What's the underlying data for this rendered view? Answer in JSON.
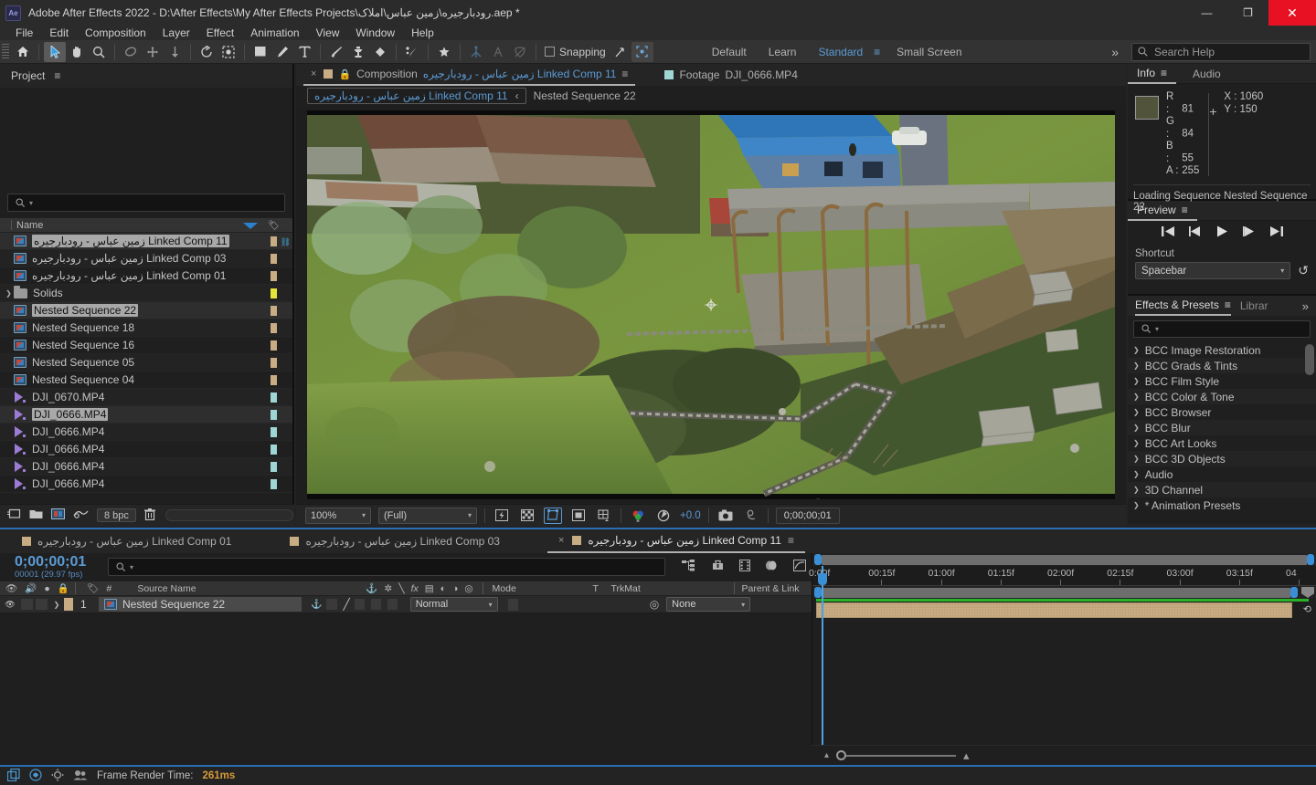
{
  "window": {
    "title": "Adobe After Effects 2022 - D:\\After Effects\\My After Effects Projects\\رودبارجیره\\زمین عباس\\املاک.aep *",
    "logo": "Ae",
    "minimize": "—",
    "maximize": "❐",
    "close": "✕"
  },
  "menu": [
    "File",
    "Edit",
    "Composition",
    "Layer",
    "Effect",
    "Animation",
    "View",
    "Window",
    "Help"
  ],
  "toolbar": {
    "snapping_label": "Snapping",
    "workspaces": [
      "Default",
      "Learn",
      "Standard",
      "Small Screen"
    ],
    "active_workspace": "Standard",
    "overflow": "»",
    "search_placeholder": "Search Help"
  },
  "project": {
    "tab_label": "Project",
    "menu_glyph": "≡",
    "search_placeholder": "",
    "column_name": "Name",
    "bit_depth": "8 bpc",
    "items": [
      {
        "label": "زمین عباس - رودبارجیره Linked Comp 11",
        "type": "comp",
        "swatch": "#c8ad84",
        "selected": true,
        "shared": true,
        "indent": false
      },
      {
        "label": "زمین عباس - رودبارجیره Linked Comp 03",
        "type": "comp",
        "swatch": "#c8ad84",
        "selected": false,
        "shared": false,
        "indent": false
      },
      {
        "label": "زمین عباس - رودبارجیره Linked Comp 01",
        "type": "comp",
        "swatch": "#c8ad84",
        "selected": false,
        "shared": false,
        "indent": false
      },
      {
        "label": "Solids",
        "type": "folder",
        "swatch": "#e4e43a",
        "selected": false,
        "shared": false,
        "indent": true
      },
      {
        "label": "Nested Sequence 22",
        "type": "comp",
        "swatch": "#c8ad84",
        "selected": true,
        "shared": false,
        "indent": false
      },
      {
        "label": "Nested Sequence 18",
        "type": "comp",
        "swatch": "#c8ad84",
        "selected": false,
        "shared": false,
        "indent": false
      },
      {
        "label": "Nested Sequence 16",
        "type": "comp",
        "swatch": "#c8ad84",
        "selected": false,
        "shared": false,
        "indent": false
      },
      {
        "label": "Nested Sequence 05",
        "type": "comp",
        "swatch": "#c8ad84",
        "selected": false,
        "shared": false,
        "indent": false
      },
      {
        "label": "Nested Sequence 04",
        "type": "comp",
        "swatch": "#c8ad84",
        "selected": false,
        "shared": false,
        "indent": false
      },
      {
        "label": "DJI_0670.MP4",
        "type": "video",
        "swatch": "#9ed6d6",
        "selected": false,
        "shared": false,
        "indent": false
      },
      {
        "label": "DJI_0666.MP4",
        "type": "video",
        "swatch": "#9ed6d6",
        "selected": true,
        "shared": false,
        "indent": false
      },
      {
        "label": "DJI_0666.MP4",
        "type": "video",
        "swatch": "#9ed6d6",
        "selected": false,
        "shared": false,
        "indent": false
      },
      {
        "label": "DJI_0666.MP4",
        "type": "video",
        "swatch": "#9ed6d6",
        "selected": false,
        "shared": false,
        "indent": false
      },
      {
        "label": "DJI_0666.MP4",
        "type": "video",
        "swatch": "#9ed6d6",
        "selected": false,
        "shared": false,
        "indent": false
      },
      {
        "label": "DJI_0666.MP4",
        "type": "video",
        "swatch": "#9ed6d6",
        "selected": false,
        "shared": false,
        "indent": false
      }
    ]
  },
  "viewer": {
    "tabs": [
      {
        "close": "×",
        "kind": "Composition",
        "name": "زمین عباس - رودبارجیره Linked Comp 11",
        "selected": true,
        "locked": true,
        "menu": "≡"
      },
      {
        "close": "",
        "kind": "Footage",
        "name": "DJI_0666.MP4",
        "selected": false,
        "locked": false,
        "menu": ""
      }
    ],
    "breadcrumb": {
      "comp": "زمین عباس - رودبارجیره Linked Comp 11",
      "chevron": "‹",
      "child": "Nested Sequence 22"
    },
    "zoom": "100%",
    "resolution": "(Full)",
    "exposure": "+0.0",
    "timecode": "0;00;00;01"
  },
  "info": {
    "tabs": [
      "Info",
      "Audio"
    ],
    "active_tab": "Info",
    "menu_glyph": "≡",
    "color_hex": "#51543a",
    "r_label": "R :",
    "r_value": "81",
    "g_label": "G :",
    "g_value": "84",
    "b_label": "B :",
    "b_value": "55",
    "a_label": "A :",
    "a_value": "255",
    "x_label": "X :",
    "x_value": "1060",
    "y_label": "Y :",
    "y_value": "150",
    "status": "Loading Sequence Nested Sequence 22"
  },
  "preview": {
    "tab_label": "Preview",
    "menu_glyph": "≡",
    "transport": [
      "first-frame",
      "prev-frame",
      "play",
      "next-frame",
      "last-frame"
    ],
    "shortcut_label": "Shortcut",
    "shortcut_value": "Spacebar",
    "reset_glyph": "↺"
  },
  "effects": {
    "tabs": [
      "Effects & Presets",
      "Librar"
    ],
    "active_tab": "Effects & Presets",
    "menu_glyph": "≡",
    "overflow": "»",
    "search_placeholder": "",
    "categories": [
      "* Animation Presets",
      "3D Channel",
      "Audio",
      "BCC 3D Objects",
      "BCC Art Looks",
      "BCC Blur",
      "BCC Browser",
      "BCC Color & Tone",
      "BCC Film Style",
      "BCC Grads & Tints",
      "BCC Image Restoration"
    ]
  },
  "timeline": {
    "tabs": [
      {
        "name": "زمین عباس - رودبارجیره Linked Comp 01",
        "selected": false,
        "close": "",
        "menu": ""
      },
      {
        "name": "زمین عباس - رودبارجیره Linked Comp 03",
        "selected": false,
        "close": "",
        "menu": ""
      },
      {
        "name": "زمین عباس - رودبارجیره Linked Comp 11",
        "selected": true,
        "close": "×",
        "menu": "≡"
      }
    ],
    "timecode": "0;00;00;01",
    "frame_info": "00001 (29.97 fps)",
    "search_placeholder": "",
    "columns": {
      "source_name": "Source Name",
      "mode": "Mode",
      "t": "T",
      "trkmat": "TrkMat",
      "parent_link": "Parent & Link",
      "hash": "#"
    },
    "layers": [
      {
        "index": "1",
        "name": "Nested Sequence 22",
        "mode": "Normal",
        "parent": "None",
        "label_color": "#c8ad84"
      }
    ],
    "ruler_ticks": [
      "0:00f",
      "00:15f",
      "01:00f",
      "01:15f",
      "02:00f",
      "02:15f",
      "03:00f",
      "03:15f",
      "04"
    ]
  },
  "status": {
    "label": "Frame Render Time:",
    "value": "261ms"
  }
}
